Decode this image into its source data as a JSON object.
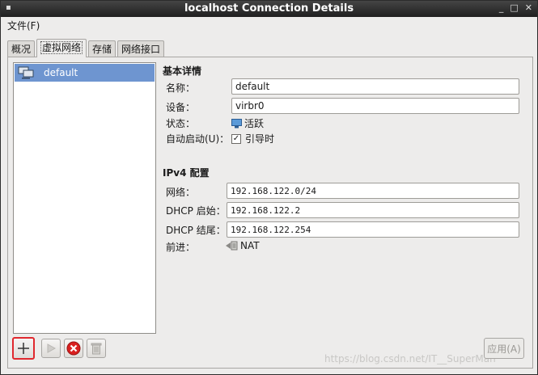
{
  "window": {
    "title": "localhost Connection Details"
  },
  "menu": {
    "file": "文件(F)"
  },
  "tabs": [
    {
      "label": "概况"
    },
    {
      "label": "虚拟网络"
    },
    {
      "label": "存储"
    },
    {
      "label": "网络接口"
    }
  ],
  "networks": [
    {
      "name": "default"
    }
  ],
  "basic": {
    "title": "基本详情",
    "name_label": "名称：",
    "name_value": "default",
    "device_label": "设备：",
    "device_value": "virbr0",
    "state_label": "状态：",
    "state_value": "活跃",
    "autostart_label": "自动启动(U)：",
    "autostart_value": "引导时",
    "autostart_checked": true
  },
  "ipv4": {
    "title": "IPv4 配置",
    "network_label": "网络：",
    "network_value": "192.168.122.0/24",
    "dhcp_start_label": "DHCP 启始：",
    "dhcp_start_value": "192.168.122.2",
    "dhcp_end_label": "DHCP 结尾：",
    "dhcp_end_value": "192.168.122.254",
    "forward_label": "前进：",
    "forward_value": "NAT"
  },
  "buttons": {
    "apply": "应用(A)"
  },
  "watermark": "https://blog.csdn.net/IT__SuperMan",
  "colors": {
    "selection": "#6e95d0",
    "add_highlight": "#e0282e",
    "delete": "#d92020"
  },
  "icons": [
    "add-icon",
    "start-icon",
    "stop-icon",
    "delete-icon",
    "network-icon",
    "active-state-icon",
    "nat-icon"
  ]
}
